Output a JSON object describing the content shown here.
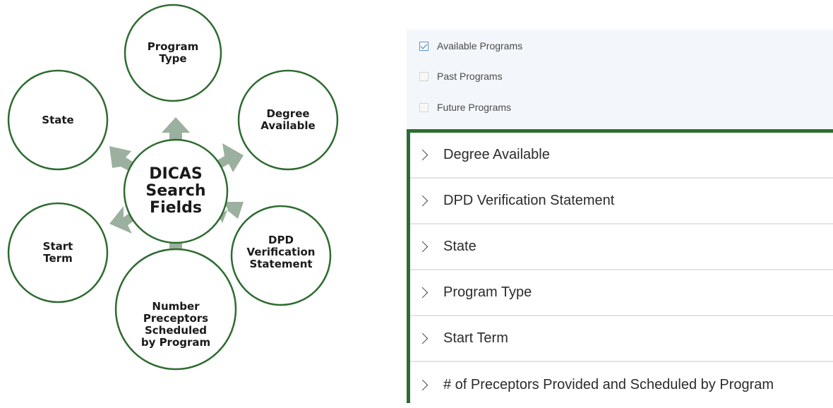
{
  "diagram": {
    "center": {
      "lines": [
        "DICAS",
        "Search",
        "Fields"
      ]
    },
    "nodes": [
      {
        "id": "program-type",
        "lines": [
          "Program",
          "Type"
        ]
      },
      {
        "id": "degree-available",
        "lines": [
          "Degree",
          "Available"
        ]
      },
      {
        "id": "dpd-verification",
        "lines": [
          "DPD",
          "Verification",
          "Statement"
        ]
      },
      {
        "id": "number-preceptors",
        "lines": [
          "Number",
          "Preceptors",
          "Scheduled",
          "by Program"
        ]
      },
      {
        "id": "start-term",
        "lines": [
          "Start",
          "Term"
        ]
      },
      {
        "id": "state",
        "lines": [
          "State"
        ]
      }
    ],
    "colors": {
      "circle_stroke": "#2e6b30",
      "arrow_fill": "#9bb09e"
    }
  },
  "filters": {
    "checkboxes": [
      {
        "label": "Available Programs",
        "checked": true
      },
      {
        "label": "Past Programs",
        "checked": false
      },
      {
        "label": "Future Programs",
        "checked": false
      }
    ],
    "accordion": [
      {
        "label": "Degree Available"
      },
      {
        "label": "DPD Verification Statement"
      },
      {
        "label": "State"
      },
      {
        "label": "Program Type"
      },
      {
        "label": "Start Term"
      },
      {
        "label": "# of Preceptors Provided and Scheduled by Program"
      }
    ],
    "border_color": "#2e6b30"
  }
}
